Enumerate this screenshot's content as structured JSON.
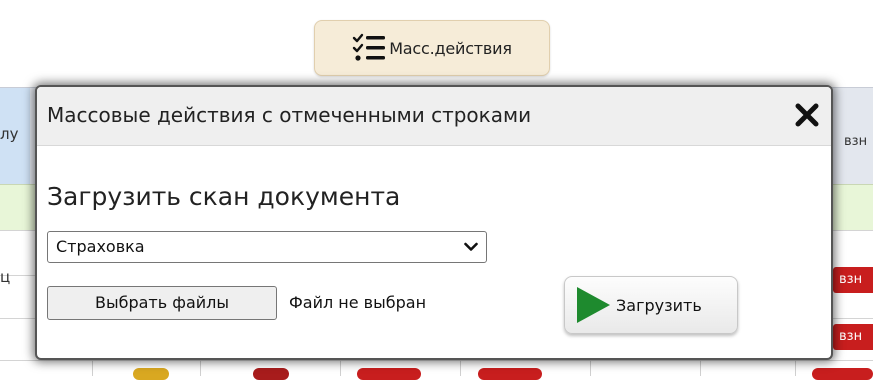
{
  "toolbar": {
    "mass_actions_label": "Масс.действия",
    "mass_actions_icon": "checklist-icon"
  },
  "background": {
    "left_header_text": "лу",
    "right_header_text": "взн",
    "left_mark": "ц",
    "badges": [
      "взн",
      "взн"
    ]
  },
  "modal": {
    "title": "Массовые действия с отмеченными строками",
    "close_icon": "close-icon",
    "section_title": "Загрузить скан документа",
    "doc_type_select": {
      "selected": "Страховка"
    },
    "choose_files_label": "Выбрать файлы",
    "file_status": "Файл не выбран",
    "upload_label": "Загрузить",
    "upload_icon": "play-icon"
  },
  "colors": {
    "upload_green": "#1e8a2e",
    "badge_red": "#c81e1e",
    "toolbar_button_bg": "#f6ecd8"
  }
}
